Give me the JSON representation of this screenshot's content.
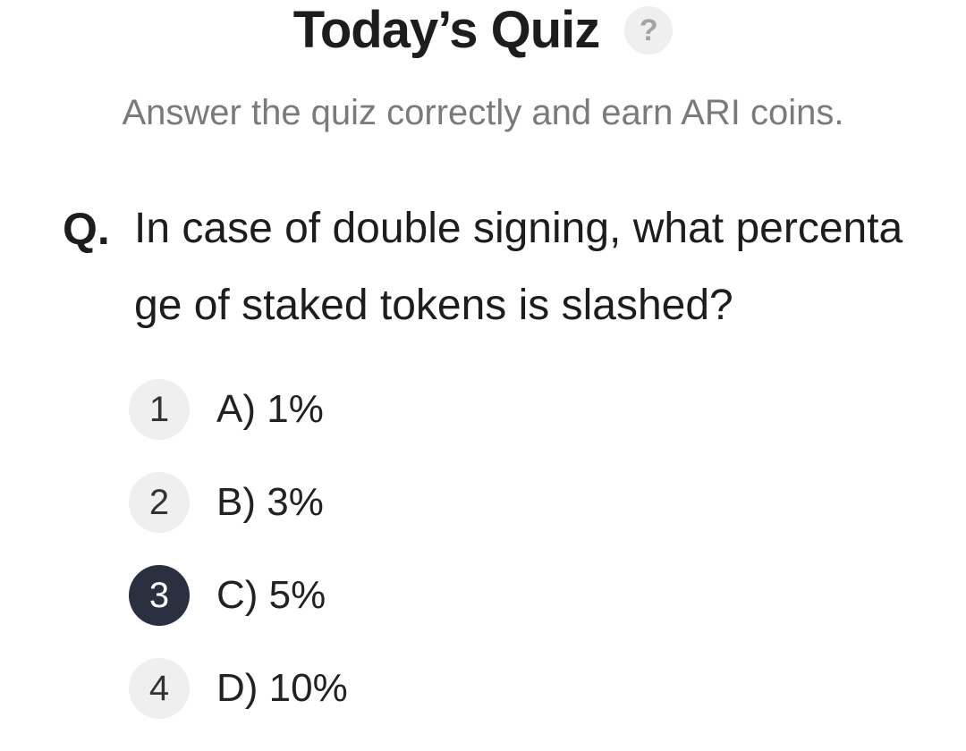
{
  "header": {
    "title": "Today’s Quiz",
    "help_icon": "question-mark-icon",
    "help_symbol": "?",
    "subtitle": "Answer the quiz correctly and earn ARI coins."
  },
  "question": {
    "prefix": "Q.",
    "text": "In case of double signing, what percentage of staked tokens is slashed?"
  },
  "options": [
    {
      "number": "1",
      "label": "A) 1%",
      "selected": false
    },
    {
      "number": "2",
      "label": "B) 3%",
      "selected": false
    },
    {
      "number": "3",
      "label": "C) 5%",
      "selected": true
    },
    {
      "number": "4",
      "label": "D) 10%",
      "selected": false
    }
  ],
  "colors": {
    "selected_badge": "#2a3040",
    "unselected_badge": "#efefef",
    "subtitle_text": "#7a7a7a"
  }
}
